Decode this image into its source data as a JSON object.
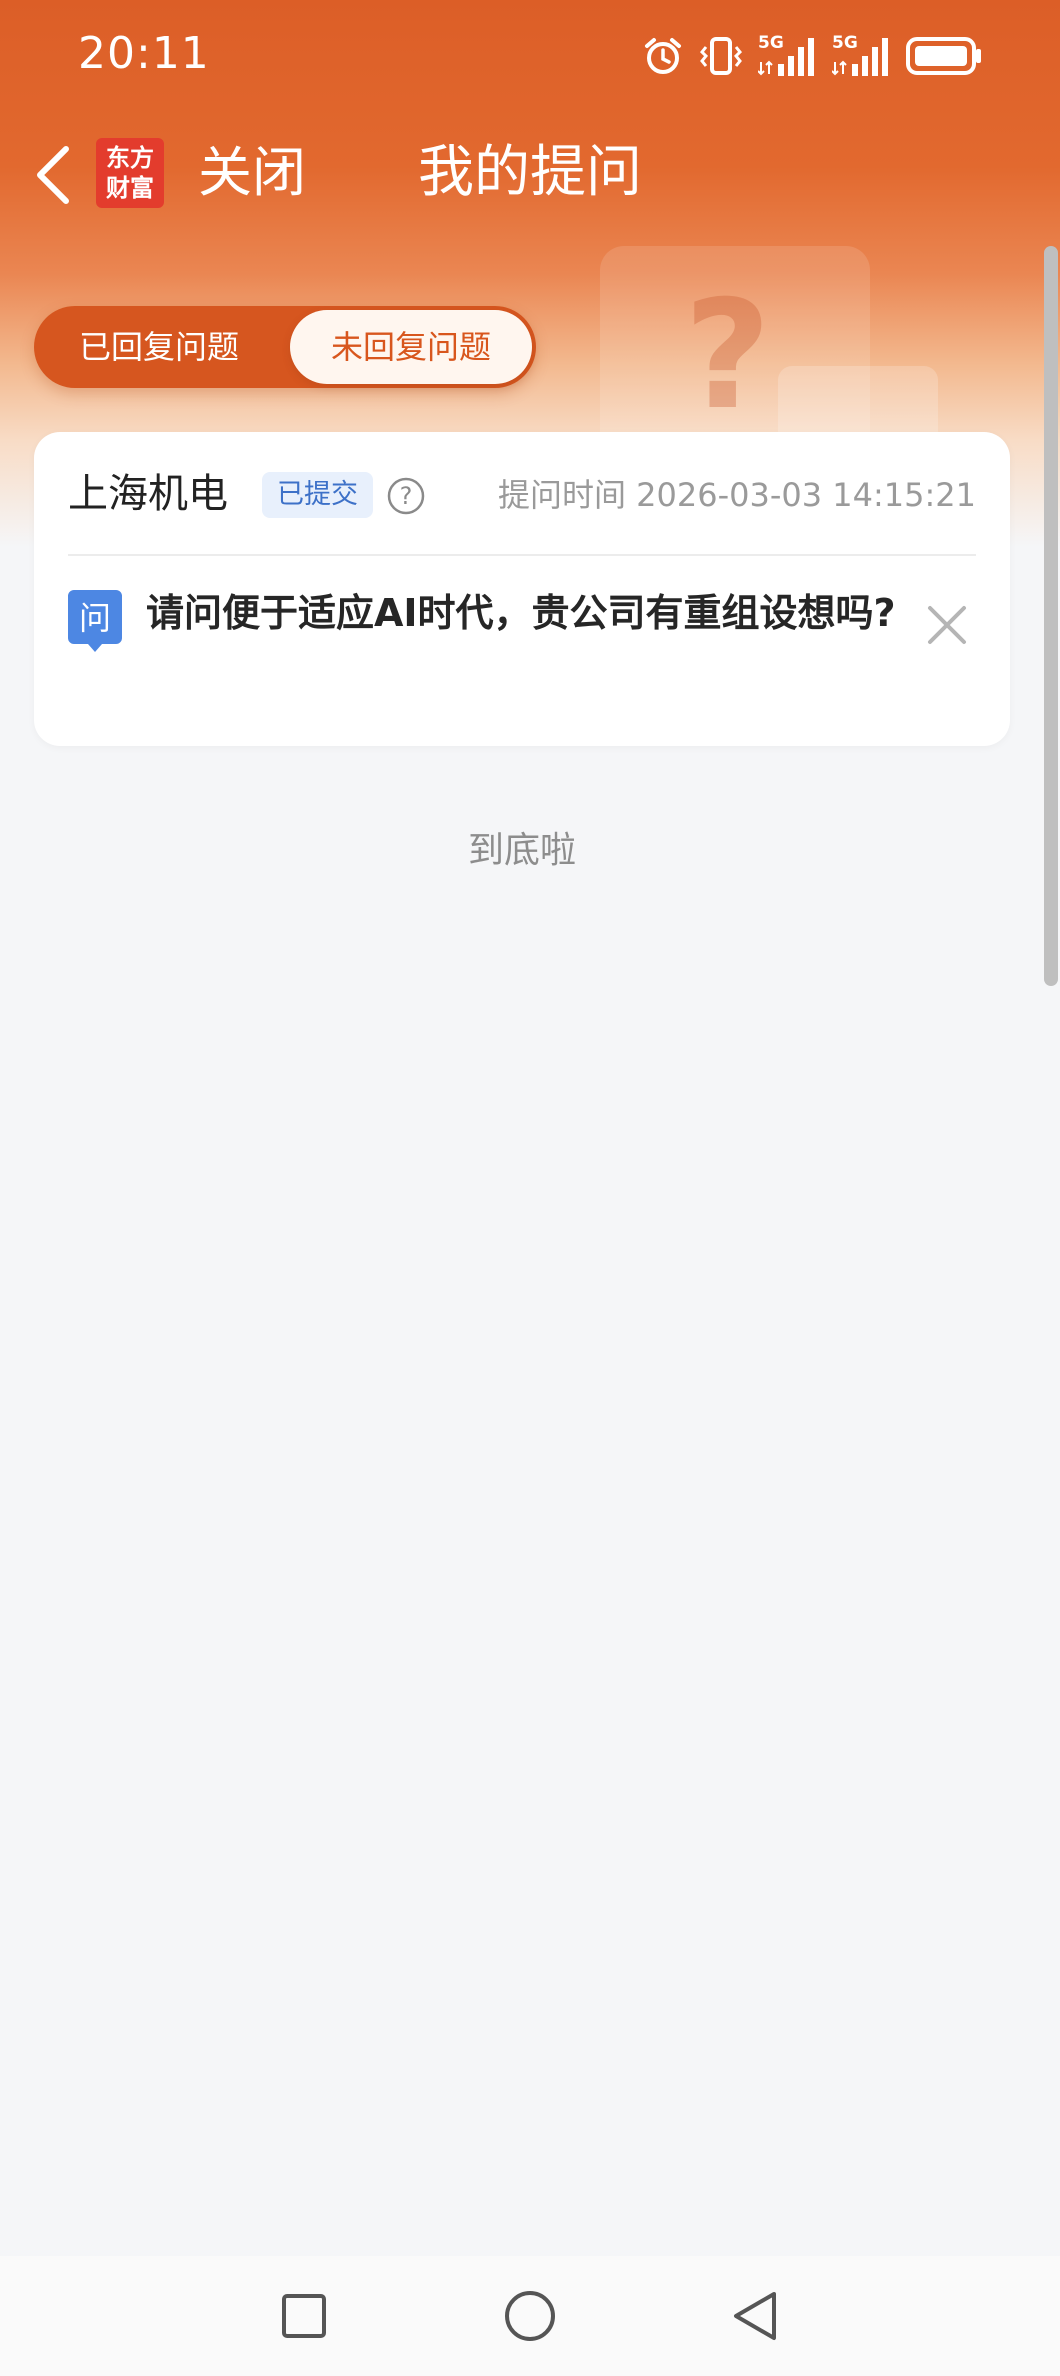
{
  "status_bar": {
    "time": "20:11",
    "icons": [
      "alarm-icon",
      "vibrate-icon",
      "5g-signal-icon",
      "5g-signal-icon",
      "battery-icon"
    ],
    "network_labels": [
      "5G",
      "5G"
    ]
  },
  "nav": {
    "back_icon": "chevron-left-icon",
    "logo_text": [
      "东方",
      "财富"
    ],
    "close_label": "关闭",
    "title": "我的提问"
  },
  "tabs": [
    {
      "label": "已回复问题",
      "selected": false
    },
    {
      "label": "未回复问题",
      "selected": true
    }
  ],
  "question_card": {
    "company": "上海机电",
    "status": "已提交",
    "help_icon": "question-circle-icon",
    "time_label": "提问时间 2026-03-03 14:15:21",
    "ask_icon_label": "问",
    "question": "请问便于适应AI时代，贵公司有重组设想吗?",
    "delete_icon": "close-icon"
  },
  "end_text": "到底啦",
  "colors": {
    "brand_orange": "#dc5e27",
    "logo_red": "#e33c2d",
    "badge_blue": "#3d71c8",
    "background": "#f5f6f8"
  },
  "system_nav": [
    "square-icon",
    "circle-icon",
    "triangle-back-icon"
  ]
}
